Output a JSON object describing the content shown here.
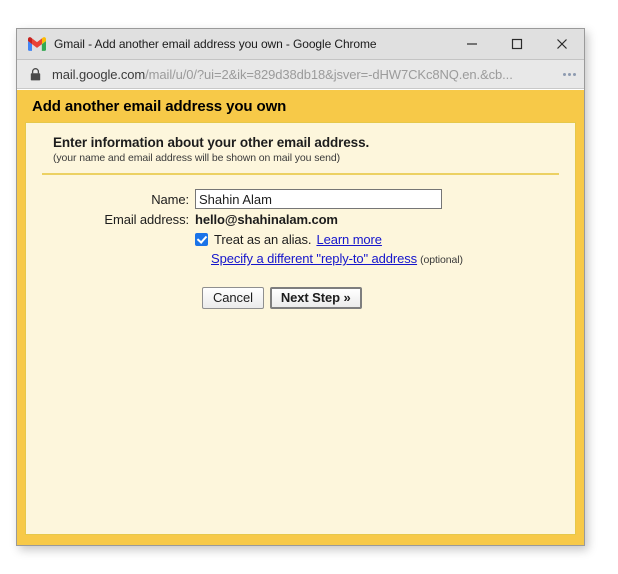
{
  "browser": {
    "window_title": "Gmail - Add another email address you own - Google Chrome",
    "favicon": "gmail-logo-icon",
    "url_domain": "mail.google.com",
    "url_path": "/mail/u/0/?ui=2&ik=829d38db18&jsver=-dHW7CKc8NQ.en.&cb...",
    "lock_icon": "lock-icon",
    "minimize_label": "minimize-icon",
    "maximize_label": "maximize-icon",
    "close_label": "close-icon",
    "menu_label": "overflow-menu-icon"
  },
  "page": {
    "header_title": "Add another email address you own",
    "intro_title": "Enter information about your other email address.",
    "intro_subtitle": "(your name and email address will be shown on mail you send)"
  },
  "form": {
    "name_label": "Name:",
    "name_value": "Shahin Alam",
    "name_placeholder": "",
    "email_label": "Email address:",
    "email_value": "hello@shahinalam.com",
    "alias_checkbox_checked": true,
    "alias_text": "Treat as an alias.",
    "learn_more_link": "Learn more",
    "reply_to_link": "Specify a different \"reply-to\" address",
    "optional_note": "(optional)"
  },
  "buttons": {
    "cancel_label": "Cancel",
    "next_label": "Next Step »"
  },
  "colors": {
    "page_header_bg": "#f7c948",
    "panel_bg": "#fdf6dc",
    "panel_border": "#e6c84a",
    "divider": "#ecd163",
    "link": "#1515cc",
    "checkbox": "#1a73e8",
    "titlebar_bg": "#e0e0e0",
    "urlbar_bg": "#e8e8e8"
  }
}
